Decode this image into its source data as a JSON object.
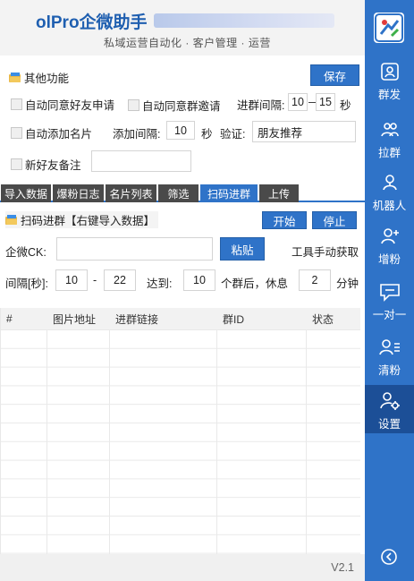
{
  "app": {
    "title": "olPro企微助手",
    "subtitle": "私域运营自动化 · 客户管理 · 运营"
  },
  "other_features": {
    "title": "其他功能",
    "save_label": "保存",
    "auto_accept_friend": "自动同意好友申请",
    "auto_accept_group": "自动同意群邀请",
    "join_interval_label": "进群间隔:",
    "join_interval_min": "10",
    "join_interval_dash": "—",
    "join_interval_max": "15",
    "join_interval_unit": "秒",
    "auto_add_card": "自动添加名片",
    "add_interval_label": "添加间隔:",
    "add_interval_value": "10",
    "add_interval_unit": "秒",
    "verify_label": "验证:",
    "verify_value": "朋友推荐",
    "new_friend_note": "新好友备注",
    "new_friend_note_value": ""
  },
  "tabs": [
    {
      "label": "导入数据"
    },
    {
      "label": "爆粉日志"
    },
    {
      "label": "名片列表"
    },
    {
      "label": "筛选"
    },
    {
      "label": "扫码进群"
    },
    {
      "label": "上传"
    }
  ],
  "scan_join": {
    "title": "扫码进群【右键导入数据】",
    "start_label": "开始",
    "stop_label": "停止",
    "ck_label": "企微CK:",
    "ck_value": "",
    "paste_label": "粘贴",
    "manual_fetch_label": "工具手动获取",
    "interval_label": "间隔[秒]:",
    "interval_min": "10",
    "interval_dash": "-",
    "interval_max": "22",
    "reach_label": "达到:",
    "reach_value": "10",
    "rest_label": "个群后，休息",
    "rest_value": "2",
    "rest_unit": "分钟"
  },
  "table": {
    "columns": [
      "#",
      "图片地址",
      "进群链接",
      "群ID",
      "状态"
    ]
  },
  "sidebar": {
    "items": [
      {
        "label": "群发",
        "icon": "group-send-icon"
      },
      {
        "label": "拉群",
        "icon": "pull-group-icon"
      },
      {
        "label": "机器人",
        "icon": "robot-icon"
      },
      {
        "label": "增粉",
        "icon": "add-fans-icon"
      },
      {
        "label": "一对一",
        "icon": "chat-icon"
      },
      {
        "label": "清粉",
        "icon": "clean-fans-icon"
      },
      {
        "label": "设置",
        "icon": "settings-icon"
      }
    ]
  },
  "footer": {
    "version": "V2.1"
  },
  "colors": {
    "accent": "#2f73c8",
    "sidebar_active": "#1c4f97",
    "tab_inactive": "#4a4a4a"
  }
}
